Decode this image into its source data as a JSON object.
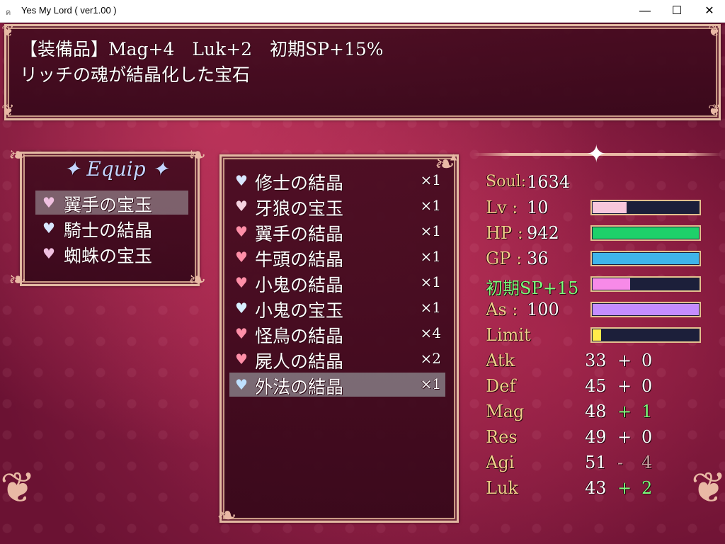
{
  "window": {
    "title": "Yes My Lord ( ver1.00 )",
    "min": "—",
    "max": "☐",
    "close": "✕"
  },
  "help": {
    "line1": "【装備品】Mag+4　Luk+2　初期SP+15%",
    "line2": "リッチの魂が結晶化した宝石"
  },
  "equip": {
    "title": "✦ Equip ✦",
    "items": [
      {
        "label": "翼手の宝玉",
        "gem_color": "#f0c0e0"
      },
      {
        "label": "騎士の結晶",
        "gem_color": "#d8e6ff"
      },
      {
        "label": "蜘蛛の宝玉",
        "gem_color": "#f0c0e0"
      }
    ]
  },
  "items": [
    {
      "name": "修士の結晶",
      "count": "×1",
      "gem_color": "#d8e6ff"
    },
    {
      "name": "牙狼の宝玉",
      "count": "×1",
      "gem_color": "#f5d2e0"
    },
    {
      "name": "翼手の結晶",
      "count": "×1",
      "gem_color": "#ff8fa8"
    },
    {
      "name": "牛頭の結晶",
      "count": "×1",
      "gem_color": "#ff8fa8"
    },
    {
      "name": "小鬼の結晶",
      "count": "×1",
      "gem_color": "#ff8fa8"
    },
    {
      "name": "小鬼の宝玉",
      "count": "×1",
      "gem_color": "#d8f0ff"
    },
    {
      "name": "怪鳥の結晶",
      "count": "×4",
      "gem_color": "#ff8fa8"
    },
    {
      "name": "屍人の結晶",
      "count": "×2",
      "gem_color": "#ff8fa8"
    },
    {
      "name": "外法の結晶",
      "count": "×1",
      "gem_color": "#bfe0ff"
    }
  ],
  "status": {
    "soul": {
      "label": "Soul",
      "sep": ":",
      "value": "1634"
    },
    "lv": {
      "label": "Lv",
      "sep": ":",
      "value": "10",
      "fill": 0.32,
      "color": "#f7c6dc"
    },
    "hp": {
      "label": "HP",
      "sep": ":",
      "value": "942",
      "fill": 1.0,
      "color": "#1ed06a"
    },
    "gp": {
      "label": "GP",
      "sep": ":",
      "value": "36",
      "fill": 1.0,
      "color": "#3fb4ea"
    },
    "sp": {
      "label": "初期SP+15",
      "fill": 0.35,
      "color": "#f78ae8",
      "label_color": "#7cff7c"
    },
    "as": {
      "label": "As",
      "sep": ":",
      "value": "100",
      "fill": 1.0,
      "color": "#c48cff"
    },
    "limit": {
      "label": "Limit",
      "fill": 0.08,
      "color": "#ffec4a"
    },
    "params": [
      {
        "label": "Atk",
        "base": "33",
        "sign": "+",
        "mod": "0",
        "mod_color": "#ffffff"
      },
      {
        "label": "Def",
        "base": "45",
        "sign": "+",
        "mod": "0",
        "mod_color": "#ffffff"
      },
      {
        "label": "Mag",
        "base": "48",
        "sign": "+",
        "mod": "1",
        "mod_color": "#7cff7c"
      },
      {
        "label": "Res",
        "base": "49",
        "sign": "+",
        "mod": "0",
        "mod_color": "#ffffff"
      },
      {
        "label": "Agi",
        "base": "51",
        "sign": "-",
        "mod": "4",
        "mod_color": "#c8a0a0"
      },
      {
        "label": "Luk",
        "base": "43",
        "sign": "+",
        "mod": "2",
        "mod_color": "#7cff7c"
      }
    ]
  }
}
